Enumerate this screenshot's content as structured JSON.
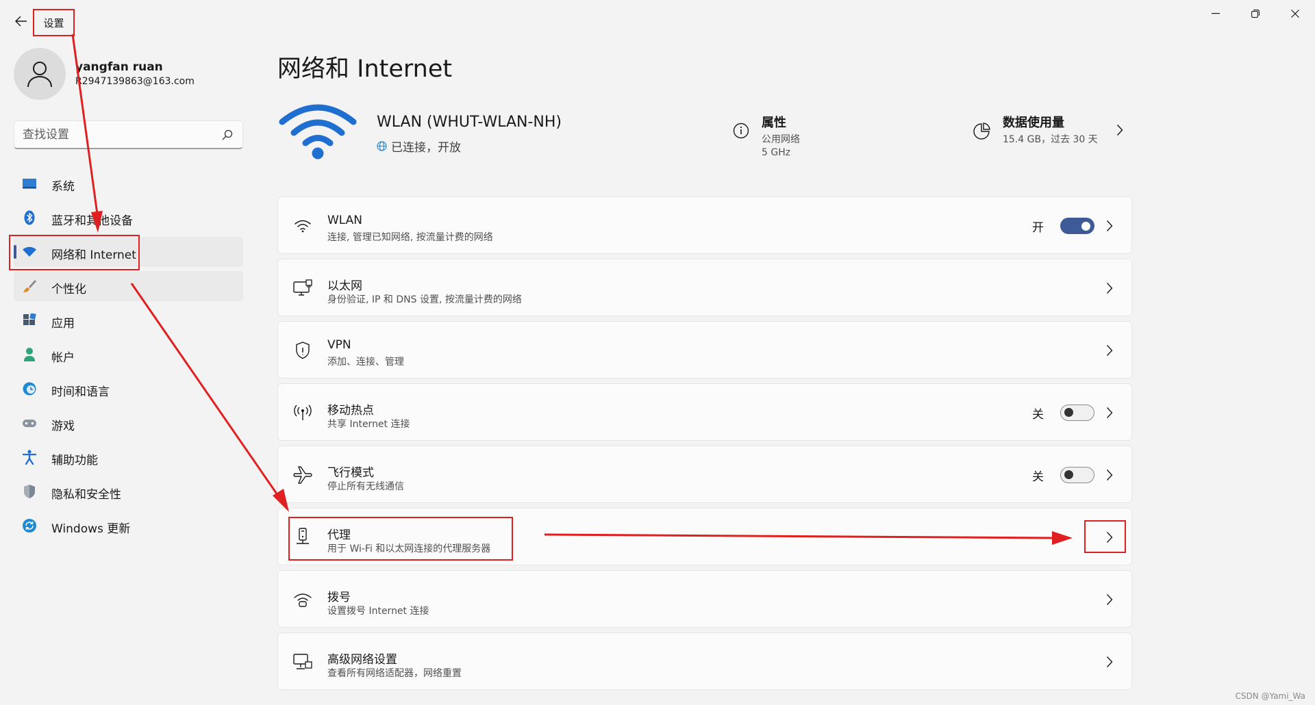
{
  "window": {
    "title": "设置"
  },
  "user": {
    "name": "yangfan ruan",
    "email": "R2947139863@163.com"
  },
  "search": {
    "placeholder": "查找设置"
  },
  "sidebar": {
    "items": [
      {
        "label": "系统",
        "icon": "display-icon"
      },
      {
        "label": "蓝牙和其他设备",
        "icon": "bluetooth-icon"
      },
      {
        "label": "网络和 Internet",
        "icon": "wifi-icon",
        "active": true
      },
      {
        "label": "个性化",
        "icon": "brush-icon"
      },
      {
        "label": "应用",
        "icon": "apps-icon"
      },
      {
        "label": "帐户",
        "icon": "person-icon"
      },
      {
        "label": "时间和语言",
        "icon": "clock-globe-icon"
      },
      {
        "label": "游戏",
        "icon": "gamepad-icon"
      },
      {
        "label": "辅助功能",
        "icon": "accessibility-icon"
      },
      {
        "label": "隐私和安全性",
        "icon": "shield-icon"
      },
      {
        "label": "Windows 更新",
        "icon": "update-icon"
      }
    ]
  },
  "page": {
    "title": "网络和 Internet"
  },
  "network": {
    "name": "WLAN (WHUT-WLAN-NH)",
    "status": "已连接，开放",
    "properties": {
      "title": "属性",
      "line1": "公用网络",
      "line2": "5 GHz"
    },
    "data_usage": {
      "title": "数据使用量",
      "detail": "15.4 GB，过去 30 天"
    }
  },
  "cards": [
    {
      "title": "WLAN",
      "sub": "连接, 管理已知网络, 按流量计费的网络",
      "icon": "wifi-icon",
      "toggle": "开",
      "toggle_on": true
    },
    {
      "title": "以太网",
      "sub": "身份验证, IP 和 DNS 设置, 按流量计费的网络",
      "icon": "ethernet-icon"
    },
    {
      "title": "VPN",
      "sub": "添加、连接、管理",
      "icon": "vpn-shield-icon"
    },
    {
      "title": "移动热点",
      "sub": "共享 Internet 连接",
      "icon": "hotspot-icon",
      "toggle": "关",
      "toggle_on": false
    },
    {
      "title": "飞行模式",
      "sub": "停止所有无线通信",
      "icon": "airplane-icon",
      "toggle": "关",
      "toggle_on": false
    },
    {
      "title": "代理",
      "sub": "用于 Wi-Fi 和以太网连接的代理服务器",
      "icon": "proxy-icon"
    },
    {
      "title": "拨号",
      "sub": "设置拨号 Internet 连接",
      "icon": "dialup-icon"
    },
    {
      "title": "高级网络设置",
      "sub": "查看所有网络适配器，网络重置",
      "icon": "advanced-network-icon"
    }
  ],
  "watermark": "CSDN @Yami_Wa",
  "colors": {
    "accent": "#3e5a97",
    "annotation": "#e02020",
    "background": "#f3f3f3",
    "card": "#fbfbfb"
  }
}
